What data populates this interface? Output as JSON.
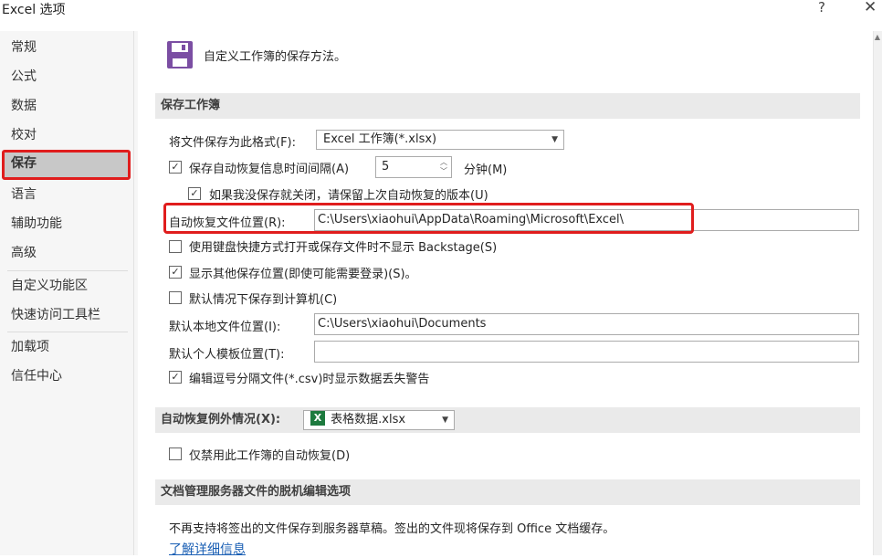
{
  "window": {
    "title": "Excel 选项",
    "help": "?",
    "close": "✕"
  },
  "sidebar": {
    "items": [
      {
        "label": "常规"
      },
      {
        "label": "公式"
      },
      {
        "label": "数据"
      },
      {
        "label": "校对"
      },
      {
        "label": "保存",
        "active": true
      },
      {
        "label": "语言"
      },
      {
        "label": "辅助功能"
      },
      {
        "label": "高级"
      },
      {
        "label": "自定义功能区"
      },
      {
        "label": "快速访问工具栏"
      },
      {
        "label": "加载项"
      },
      {
        "label": "信任中心"
      }
    ]
  },
  "main": {
    "page_title": "自定义工作簿的保存方法。",
    "save_workbooks": {
      "header": "保存工作簿",
      "format_label": "将文件保存为此格式(F):",
      "format_value": "Excel 工作簿(*.xlsx)",
      "autorecover_label": "保存自动恢复信息时间间隔(A)",
      "autorecover_checked": true,
      "interval_value": "5",
      "minutes_label": "分钟(M)",
      "keep_last_label": "如果我没保存就关闭，请保留上次自动恢复的版本(U)",
      "keep_last_checked": true,
      "autorecover_location_label": "自动恢复文件位置(R):",
      "autorecover_location_value": "C:\\Users\\xiaohui\\AppData\\Roaming\\Microsoft\\Excel\\",
      "no_backstage_label": "使用键盘快捷方式打开或保存文件时不显示 Backstage(S)",
      "no_backstage_checked": false,
      "show_more_label": "显示其他保存位置(即使可能需要登录)(S)。",
      "show_more_checked": true,
      "default_computer_label": "默认情况下保存到计算机(C)",
      "default_computer_checked": false,
      "local_location_label": "默认本地文件位置(I):",
      "local_location_value": "C:\\Users\\xiaohui\\Documents",
      "template_location_label": "默认个人模板位置(T):",
      "template_location_value": "",
      "csv_warning_label": "编辑逗号分隔文件(*.csv)时显示数据丢失警告",
      "csv_warning_checked": true
    },
    "autorecover_exceptions": {
      "header": "自动恢复例外情况(X):",
      "workbook_value": "表格数据.xlsx",
      "disable_label": "仅禁用此工作簿的自动恢复(D)",
      "disable_checked": false
    },
    "offline_editing": {
      "header": "文档管理服务器文件的脱机编辑选项",
      "description": "不再支持将签出的文件保存到服务器草稿。签出的文件现将保存到 Office 文档缓存。",
      "learn_more": "了解详细信息"
    }
  },
  "colors": {
    "accent_purple": "#7b4ea3",
    "highlight_red": "#e01d1d",
    "excel_green": "#1d7a3e"
  },
  "icons": {
    "save": "floppy-disk-icon",
    "excel_file": "excel-file-icon"
  }
}
